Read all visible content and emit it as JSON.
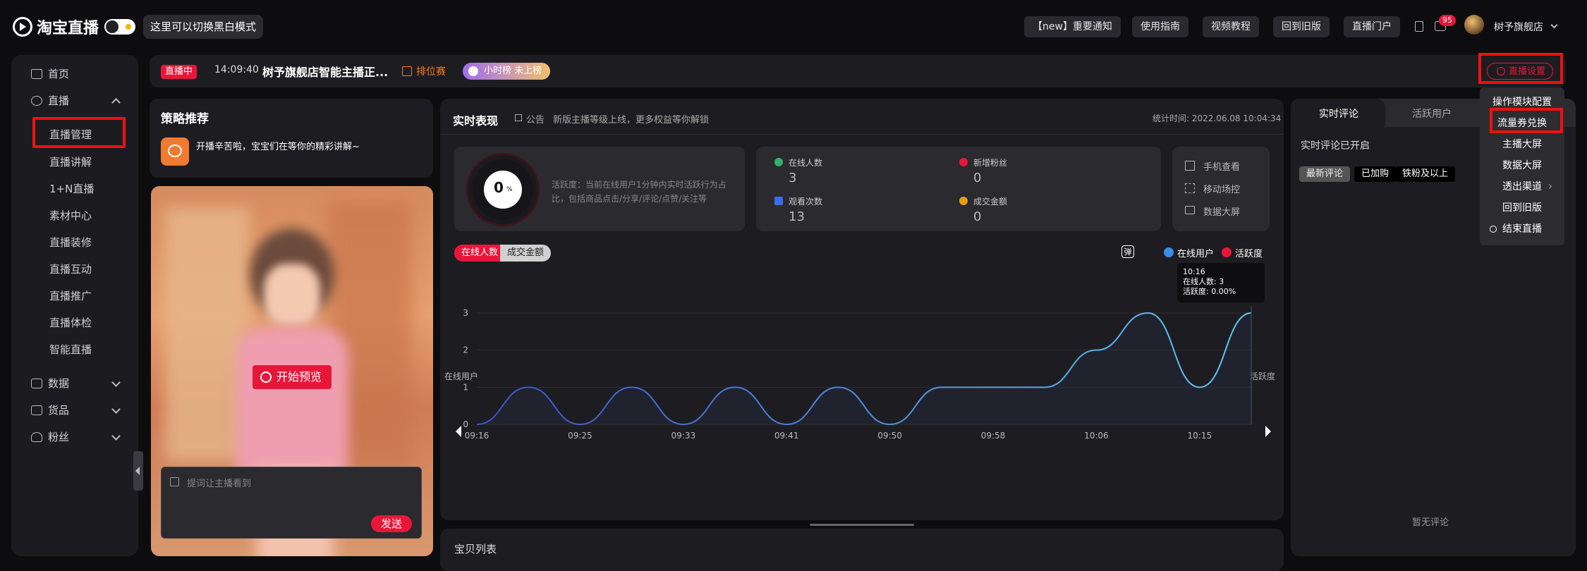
{
  "header": {
    "logo_text": "淘宝直播",
    "mode_hint": "这里可以切换黑白模式",
    "nav": [
      "【new】重要通知",
      "使用指南",
      "视频教程",
      "回到旧版",
      "直播门户"
    ],
    "notification_count": "95",
    "store_name": "树予旗舰店"
  },
  "sidebar": {
    "home": "首页",
    "live": "直播",
    "live_items": [
      "直播管理",
      "直播讲解",
      "1+N直播",
      "素材中心",
      "直播装修",
      "直播互动",
      "直播推广",
      "直播体检",
      "智能直播"
    ],
    "data": "数据",
    "goods": "货品",
    "fans": "粉丝"
  },
  "status_bar": {
    "live_badge": "直播中",
    "time": "14:09:40",
    "title": "树予旗舰店智能主播正...",
    "rank": "排位赛",
    "hour_rank": "小时榜 未上榜",
    "settings": "直播设置"
  },
  "strategy": {
    "title": "策略推荐",
    "tip": "开播辛苦啦，宝宝们在等你的精彩讲解~",
    "preview_button": "开始预览",
    "comment_placeholder": "提词让主播看到",
    "send": "发送"
  },
  "realtime": {
    "title": "实时表现",
    "notice_label": "公告",
    "notice": "新版主播等级上线，更多权益等你解锁",
    "stat_time": "统计时间: 2022.06.08 10:04:34",
    "gauge_value": "0",
    "gauge_unit": "%",
    "activity_desc": "活跃度：当前在线用户1分钟内实时活跃行为占比，包括商品点击/分享/评论/点赞/关注等",
    "metrics": [
      {
        "label": "在线人数",
        "value": "3",
        "color": "#2fb36a"
      },
      {
        "label": "新增粉丝",
        "value": "0",
        "color": "#e8173a"
      },
      {
        "label": "观看次数",
        "value": "13",
        "color": "#3a6ee8"
      },
      {
        "label": "成交金额",
        "value": "0",
        "color": "#e89a17"
      }
    ],
    "shortcuts": [
      "手机查看",
      "移动场控",
      "数据大屏"
    ],
    "tab_online": "在线人数",
    "tab_gmv": "成交金额",
    "danmu": "弹",
    "legend_online": "在线用户",
    "legend_active": "活跃度",
    "y_axis_left": "在线用户",
    "y_axis_right": "活跃度",
    "tooltip": {
      "time": "10:16",
      "online": "在线人数: 3",
      "active": "活跃度: 0.00%"
    }
  },
  "goods_list": {
    "title": "宝贝列表"
  },
  "right_panel": {
    "tabs": [
      "实时评论",
      "活跃用户"
    ],
    "comment_status": "实时评论已开启",
    "filters": [
      "最新评论",
      "已加购",
      "铁粉及以上"
    ],
    "empty": "暂无评论",
    "menu": [
      "操作模块配置",
      "流量券兑换",
      "主播大屏",
      "数据大屏",
      "透出渠道",
      "回到旧版",
      "结束直播"
    ]
  },
  "colors": {
    "accent": "#e8173a",
    "line": "#5ec8f0",
    "panel": "#1d1d21",
    "highlight_box": "#ee1111"
  },
  "chart_data": {
    "type": "line",
    "x": [
      "09:16",
      "09:20",
      "09:25",
      "09:29",
      "09:33",
      "09:37",
      "09:41",
      "09:45",
      "09:50",
      "09:54",
      "09:58",
      "10:02",
      "10:06",
      "10:10",
      "10:15",
      "10:16"
    ],
    "x_ticks": [
      "09:16",
      "09:25",
      "09:33",
      "09:41",
      "09:50",
      "09:58",
      "10:06",
      "10:15"
    ],
    "series": [
      {
        "name": "在线用户",
        "values": [
          0,
          1,
          0,
          1,
          0,
          1,
          0,
          1,
          0,
          1,
          1,
          1,
          2,
          3,
          1,
          3
        ]
      }
    ],
    "y_ticks": [
      "0",
      "1",
      "2",
      "3"
    ],
    "ylabel": "在线用户",
    "ylabel_right": "活跃度",
    "ylim": [
      0,
      3
    ]
  }
}
